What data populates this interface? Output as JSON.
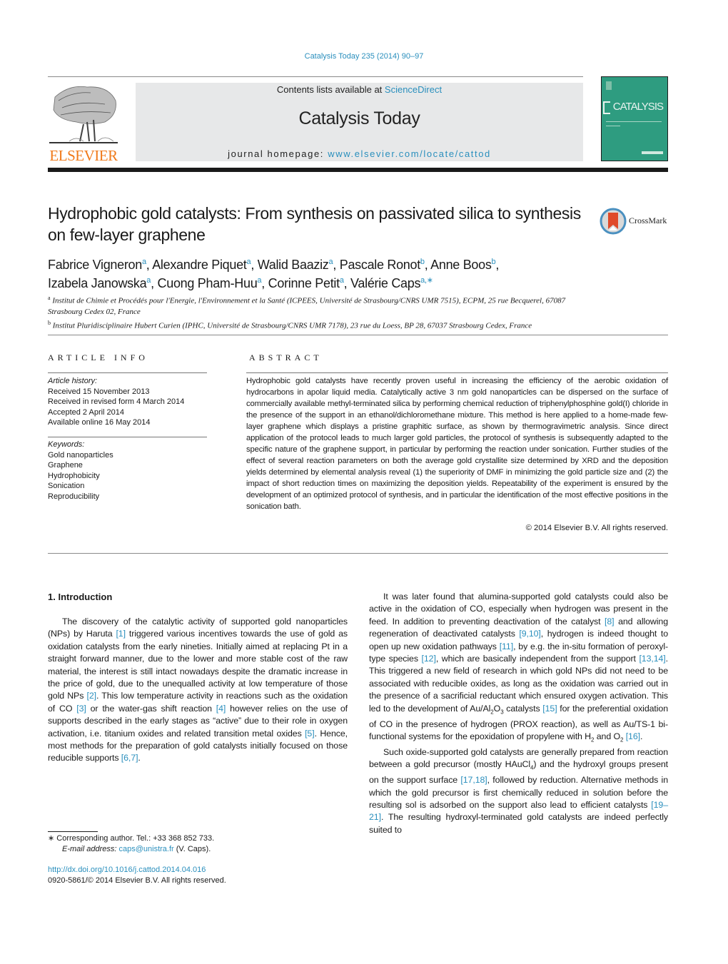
{
  "header": {
    "journal_reference": "Catalysis Today 235 (2014) 90–97",
    "publisher_logo_text": "ELSEVIER",
    "contents_prefix": "Contents lists available at ",
    "contents_link": "ScienceDirect",
    "journal_title": "Catalysis Today",
    "homepage_prefix": "journal homepage: ",
    "homepage_link": "www.elsevier.com/locate/cattod",
    "cover_title": "CATALYSIS",
    "colors": {
      "link": "#2a8fbd",
      "elsevier_orange": "#f07a1a",
      "cover_green": "#2e9c80",
      "banner_gray": "#e7e8e9"
    }
  },
  "article": {
    "title": "Hydrophobic gold catalysts: From synthesis on passivated silica to synthesis on few-layer graphene",
    "crossmark_label": "CrossMark",
    "authors": [
      {
        "name": "Fabrice Vigneron",
        "aff": "a"
      },
      {
        "name": "Alexandre Piquet",
        "aff": "a"
      },
      {
        "name": "Walid Baaziz",
        "aff": "a"
      },
      {
        "name": "Pascale Ronot",
        "aff": "b"
      },
      {
        "name": "Anne Boos",
        "aff": "b"
      },
      {
        "name": "Izabela Janowska",
        "aff": "a"
      },
      {
        "name": "Cuong Pham-Huu",
        "aff": "a"
      },
      {
        "name": "Corinne Petit",
        "aff": "a"
      },
      {
        "name": "Valérie Caps",
        "aff": "a,∗"
      }
    ],
    "affiliations": [
      {
        "key": "a",
        "text": "Institut de Chimie et Procédés pour l'Energie, l'Environnement et la Santé (ICPEES, Université de Strasbourg/CNRS UMR 7515), ECPM, 25 rue Becquerel, 67087 Strasbourg Cedex 02, France"
      },
      {
        "key": "b",
        "text": "Institut Pluridisciplinaire Hubert Curien (IPHC, Université de Strasbourg/CNRS UMR 7178), 23 rue du Loess, BP 28, 67037 Strasbourg Cedex, France"
      }
    ]
  },
  "article_info": {
    "heading": "ARTICLE INFO",
    "history_label": "Article history:",
    "history": [
      "Received 15 November 2013",
      "Received in revised form 4 March 2014",
      "Accepted 2 April 2014",
      "Available online 16 May 2014"
    ],
    "keywords_label": "Keywords:",
    "keywords": [
      "Gold nanoparticles",
      "Graphene",
      "Hydrophobicity",
      "Sonication",
      "Reproducibility"
    ]
  },
  "abstract": {
    "heading": "ABSTRACT",
    "text": "Hydrophobic gold catalysts have recently proven useful in increasing the efficiency of the aerobic oxidation of hydrocarbons in apolar liquid media. Catalytically active 3 nm gold nanoparticles can be dispersed on the surface of commercially available methyl-terminated silica by performing chemical reduction of triphenylphosphine gold(I) chloride in the presence of the support in an ethanol/dichloromethane mixture. This method is here applied to a home-made few-layer graphene which displays a pristine graphitic surface, as shown by thermogravimetric analysis. Since direct application of the protocol leads to much larger gold particles, the protocol of synthesis is subsequently adapted to the specific nature of the graphene support, in particular by performing the reaction under sonication. Further studies of the effect of several reaction parameters on both the average gold crystallite size determined by XRD and the deposition yields determined by elemental analysis reveal (1) the superiority of DMF in minimizing the gold particle size and (2) the impact of short reduction times on maximizing the deposition yields. Repeatability of the experiment is ensured by the development of an optimized protocol of synthesis, and in particular the identification of the most effective positions in the sonication bath.",
    "copyright": "© 2014 Elsevier B.V. All rights reserved."
  },
  "body": {
    "intro_heading": "1.  Introduction",
    "left_paragraphs": [
      [
        {
          "t": "The discovery of the catalytic activity of supported gold nanoparticles (NPs) by Haruta "
        },
        {
          "ref": "[1]"
        },
        {
          "t": " triggered various incentives towards the use of gold as oxidation catalysts from the early nineties. Initially aimed at replacing Pt in a straight forward manner, due to the lower and more stable cost of the raw material, the interest is still intact nowadays despite the dramatic increase in the price of gold, due to the unequalled activity at low temperature of those gold NPs "
        },
        {
          "ref": "[2]"
        },
        {
          "t": ". This low temperature activity in reactions such as the oxidation of CO "
        },
        {
          "ref": "[3]"
        },
        {
          "t": " or the water-gas shift reaction "
        },
        {
          "ref": "[4]"
        },
        {
          "t": " however relies on the use of supports described in the early stages as “active” due to their role in oxygen activation, i.e. titanium oxides and related transition metal oxides "
        },
        {
          "ref": "[5]"
        },
        {
          "t": ". Hence, most methods for the preparation of gold catalysts initially focused on those reducible supports "
        },
        {
          "ref": "[6,7]"
        },
        {
          "t": "."
        }
      ]
    ],
    "right_paragraphs": [
      [
        {
          "t": "It was later found that alumina-supported gold catalysts could also be active in the oxidation of CO, especially when hydrogen was present in the feed. In addition to preventing deactivation of the catalyst "
        },
        {
          "ref": "[8]"
        },
        {
          "t": " and allowing regeneration of deactivated catalysts "
        },
        {
          "ref": "[9,10]"
        },
        {
          "t": ", hydrogen is indeed thought to open up new oxidation pathways "
        },
        {
          "ref": "[11]"
        },
        {
          "t": ", by e.g. the in-situ formation of peroxyl-type species "
        },
        {
          "ref": "[12]"
        },
        {
          "t": ", which are basically independent from the support "
        },
        {
          "ref": "[13,14]"
        },
        {
          "t": ". This triggered a new field of research in which gold NPs did not need to be associated with reducible oxides, as long as the oxidation was carried out in the presence of a sacrificial reductant which ensured oxygen activation. This led to the development of Au/Al"
        },
        {
          "sub": "2"
        },
        {
          "t": "O"
        },
        {
          "sub": "3"
        },
        {
          "t": " catalysts "
        },
        {
          "ref": "[15]"
        },
        {
          "t": " for the preferential oxidation of CO in the presence of hydrogen (PROX reaction), as well as Au/TS-1 bi-functional systems for the epoxidation of propylene with H"
        },
        {
          "sub": "2"
        },
        {
          "t": " and O"
        },
        {
          "sub": "2"
        },
        {
          "t": " "
        },
        {
          "ref": "[16]"
        },
        {
          "t": "."
        }
      ],
      [
        {
          "t": "Such oxide-supported gold catalysts are generally prepared from reaction between a gold precursor (mostly HAuCl"
        },
        {
          "sub": "4"
        },
        {
          "t": ") and the hydroxyl groups present on the support surface "
        },
        {
          "ref": "[17,18]"
        },
        {
          "t": ", followed by reduction. Alternative methods in which the gold precursor is first chemically reduced in solution before the resulting sol is adsorbed on the support also lead to efficient catalysts "
        },
        {
          "ref": "[19–21]"
        },
        {
          "t": ". The resulting hydroxyl-terminated gold catalysts are indeed perfectly suited to"
        }
      ]
    ]
  },
  "footnotes": {
    "corresponding": "∗  Corresponding author. Tel.: +33 368 852 733.",
    "email_label": "E-mail address: ",
    "email": "caps@unistra.fr",
    "email_suffix": " (V. Caps).",
    "doi": "http://dx.doi.org/10.1016/j.cattod.2014.04.016",
    "issn_copyright": "0920-5861/© 2014 Elsevier B.V. All rights reserved."
  }
}
